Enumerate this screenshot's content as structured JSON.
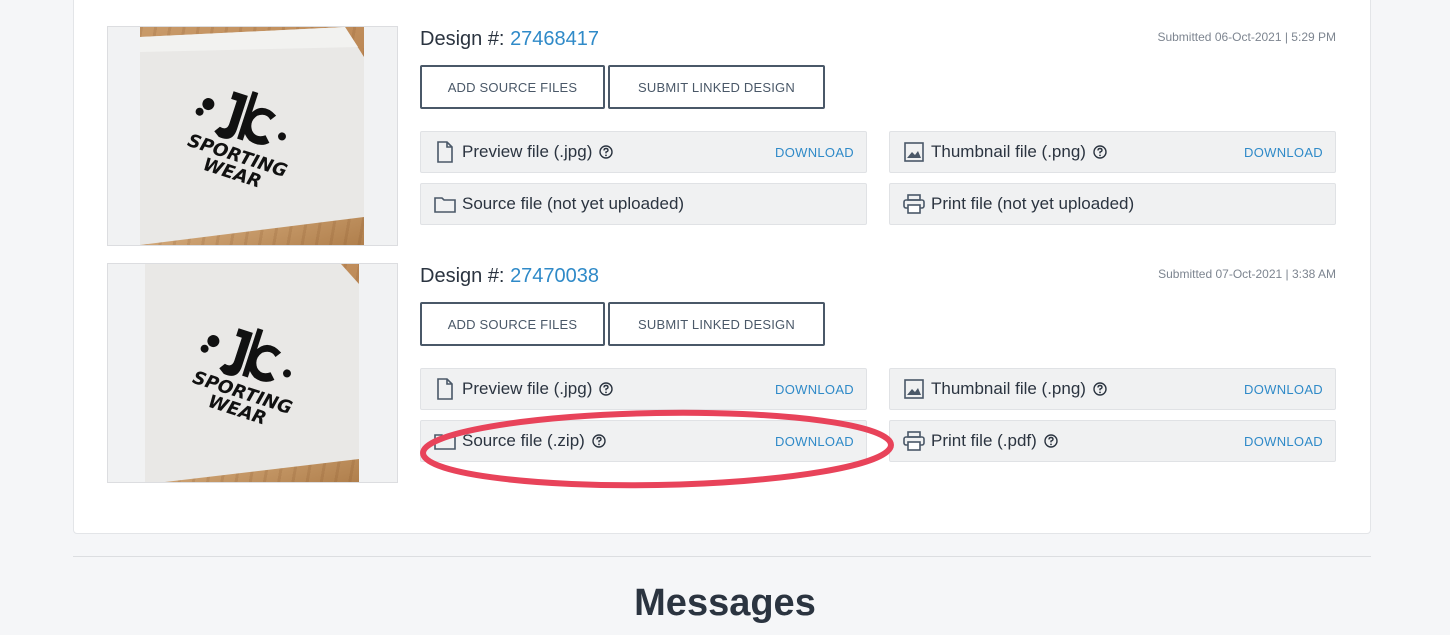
{
  "designs": [
    {
      "label": "Design #:",
      "number": "27468417",
      "submitted": "Submitted 06-Oct-2021 | 5:29 PM",
      "add_source": "ADD SOURCE FILES",
      "submit_linked": "SUBMIT LINKED DESIGN",
      "files": {
        "preview": {
          "label": "Preview file (.jpg)",
          "action": "DOWNLOAD"
        },
        "thumbnail": {
          "label": "Thumbnail file (.png)",
          "action": "DOWNLOAD"
        },
        "source": {
          "label": "Source file (not yet uploaded)"
        },
        "print": {
          "label": "Print file (not yet uploaded)"
        }
      }
    },
    {
      "label": "Design #:",
      "number": "27470038",
      "submitted": "Submitted 07-Oct-2021 | 3:38 AM",
      "add_source": "ADD SOURCE FILES",
      "submit_linked": "SUBMIT LINKED DESIGN",
      "files": {
        "preview": {
          "label": "Preview file (.jpg)",
          "action": "DOWNLOAD"
        },
        "thumbnail": {
          "label": "Thumbnail file (.png)",
          "action": "DOWNLOAD"
        },
        "source": {
          "label": "Source file (.zip)",
          "action": "DOWNLOAD"
        },
        "print": {
          "label": "Print file (.pdf)",
          "action": "DOWNLOAD"
        }
      }
    }
  ],
  "messages_heading": "Messages",
  "colors": {
    "link": "#2f8ac8",
    "annotation": "#e8435a"
  }
}
